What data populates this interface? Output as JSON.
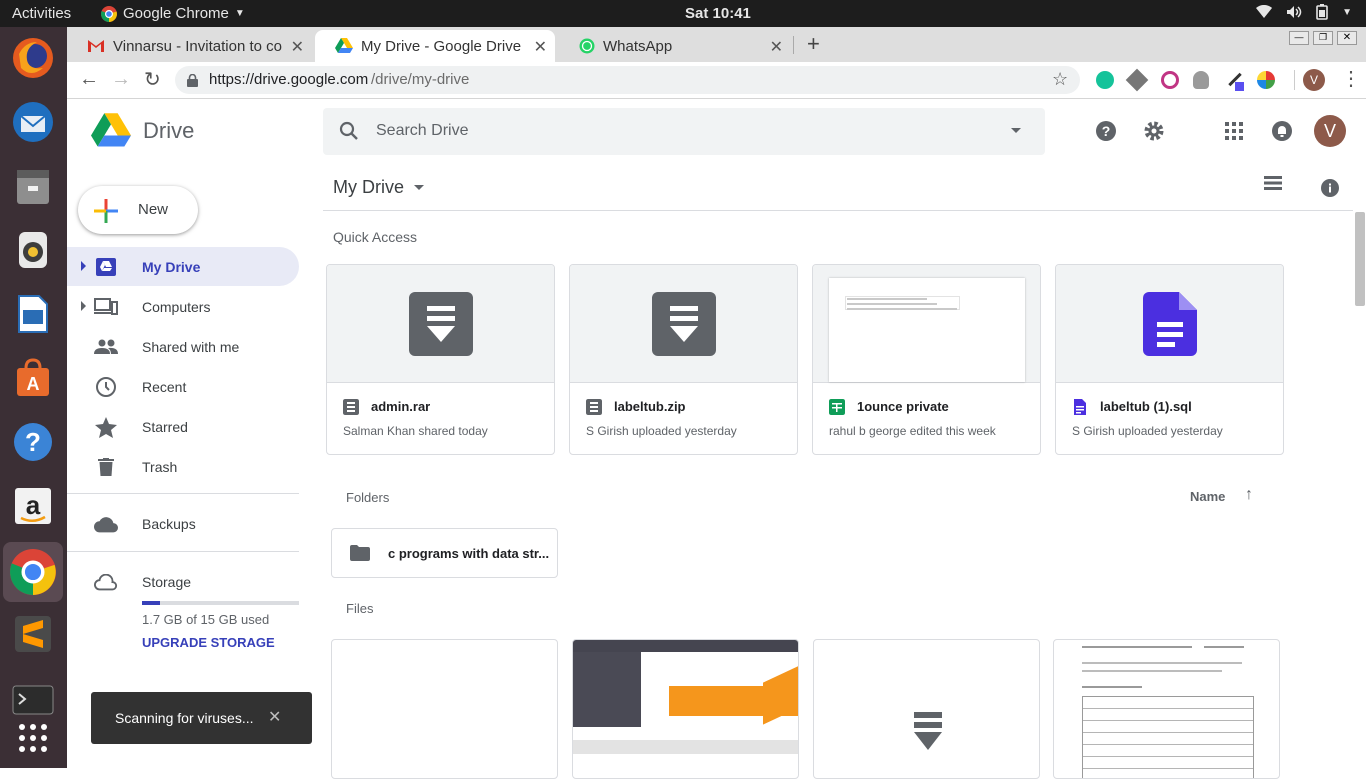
{
  "topbar": {
    "activities": "Activities",
    "app_name": "Google Chrome",
    "clock": "Sat 10:41"
  },
  "tabs": [
    {
      "title": "Vinnarsu - Invitation to co",
      "icon": "gmail-icon"
    },
    {
      "title": "My Drive - Google Drive",
      "icon": "drive-icon"
    },
    {
      "title": "WhatsApp",
      "icon": "whatsapp-icon"
    }
  ],
  "address": {
    "url_host": "https://drive.google.com",
    "url_path": "/drive/my-drive"
  },
  "avatar_letter": "V",
  "drive": {
    "logo_text": "Drive",
    "search_placeholder": "Search Drive",
    "new_label": "New",
    "nav": [
      {
        "label": "My Drive"
      },
      {
        "label": "Computers"
      },
      {
        "label": "Shared with me"
      },
      {
        "label": "Recent"
      },
      {
        "label": "Starred"
      },
      {
        "label": "Trash"
      },
      {
        "label": "Backups"
      },
      {
        "label": "Storage"
      }
    ],
    "storage_used": "1.7 GB of 15 GB used",
    "storage_fraction": 0.113,
    "upgrade_label": "UPGRADE STORAGE"
  },
  "main": {
    "title": "My Drive",
    "quick_access_label": "Quick Access",
    "quick_access": [
      {
        "name": "admin.rar",
        "sub": "Salman Khan shared today",
        "type": "archive"
      },
      {
        "name": "labeltub.zip",
        "sub": "S Girish uploaded yesterday",
        "type": "archive"
      },
      {
        "name": "1ounce private",
        "sub": "rahul b george edited this week",
        "type": "sheet"
      },
      {
        "name": "labeltub (1).sql",
        "sub": "S Girish uploaded yesterday",
        "type": "doc"
      }
    ],
    "folders_label": "Folders",
    "sort_label": "Name",
    "folders": [
      {
        "name": "c programs with data str..."
      }
    ],
    "files_label": "Files"
  },
  "snackbar": {
    "text": "Scanning for viruses..."
  },
  "colors": {
    "accent": "#3740b9",
    "dock": "#3b2f35",
    "topbar": "#1d1d1d"
  }
}
